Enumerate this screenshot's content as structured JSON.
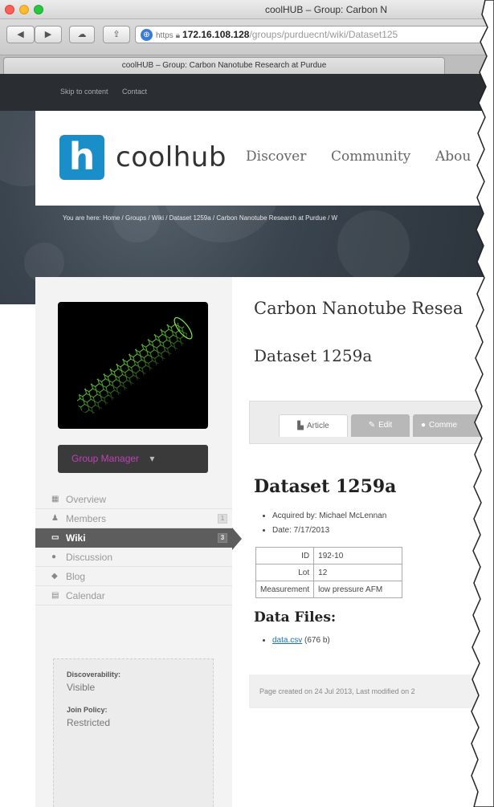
{
  "window": {
    "title": "coolHUB – Group: Carbon N"
  },
  "toolbar": {
    "back": "◀",
    "forward": "▶",
    "cloud": "☁",
    "share": "⇪",
    "url_https": "https",
    "url_host": "172.16.108.128",
    "url_path": "/groups/purduecnt/wiki/Dataset125"
  },
  "tab": {
    "title": "coolHUB – Group: Carbon Nanotube Research at Purdue"
  },
  "topbar": {
    "skip": "Skip to content",
    "contact": "Contact"
  },
  "header": {
    "logo_letter": "h",
    "logo_text": "coolhub",
    "nav": [
      "Discover",
      "Community",
      "Abou"
    ]
  },
  "breadcrumb": "You are here: Home / Groups / Wiki / Dataset 1259a / Carbon Nanotube Research at Purdue / W",
  "sidebar": {
    "manager_label": "Group Manager",
    "manager_caret": "▾",
    "items": [
      {
        "label": "Overview",
        "icon": "overview-icon",
        "count": ""
      },
      {
        "label": "Members",
        "icon": "members-icon",
        "count": "1"
      },
      {
        "label": "Wiki",
        "icon": "wiki-icon",
        "count": "3"
      },
      {
        "label": "Discussion",
        "icon": "discussion-icon",
        "count": ""
      },
      {
        "label": "Blog",
        "icon": "blog-icon",
        "count": ""
      },
      {
        "label": "Calendar",
        "icon": "calendar-icon",
        "count": ""
      }
    ],
    "info": {
      "discoverability_label": "Discoverability:",
      "discoverability_value": "Visible",
      "join_label": "Join Policy:",
      "join_value": "Restricted"
    }
  },
  "main": {
    "group_title": "Carbon Nanotube Resea",
    "page_title": "Dataset 1259a",
    "tabs": {
      "article": "Article",
      "edit": "Edit",
      "comments": "Comme"
    },
    "article_heading": "Dataset 1259a",
    "bullets": [
      "Acquired by: Michael McLennan",
      "Date: 7/17/2013"
    ],
    "table": [
      {
        "key": "ID",
        "value": "192-10"
      },
      {
        "key": "Lot",
        "value": "12"
      },
      {
        "key": "Measurement",
        "value": "low pressure AFM"
      }
    ],
    "files_heading": "Data Files:",
    "file_name": "data.csv",
    "file_size": "(676 b)",
    "footer": "Page created on 24 Jul 2013, Last modified on 2"
  },
  "colors": {
    "brand": "#1a8ec8",
    "manager_text": "#c040b8",
    "active_item": "#5d5d5d"
  }
}
